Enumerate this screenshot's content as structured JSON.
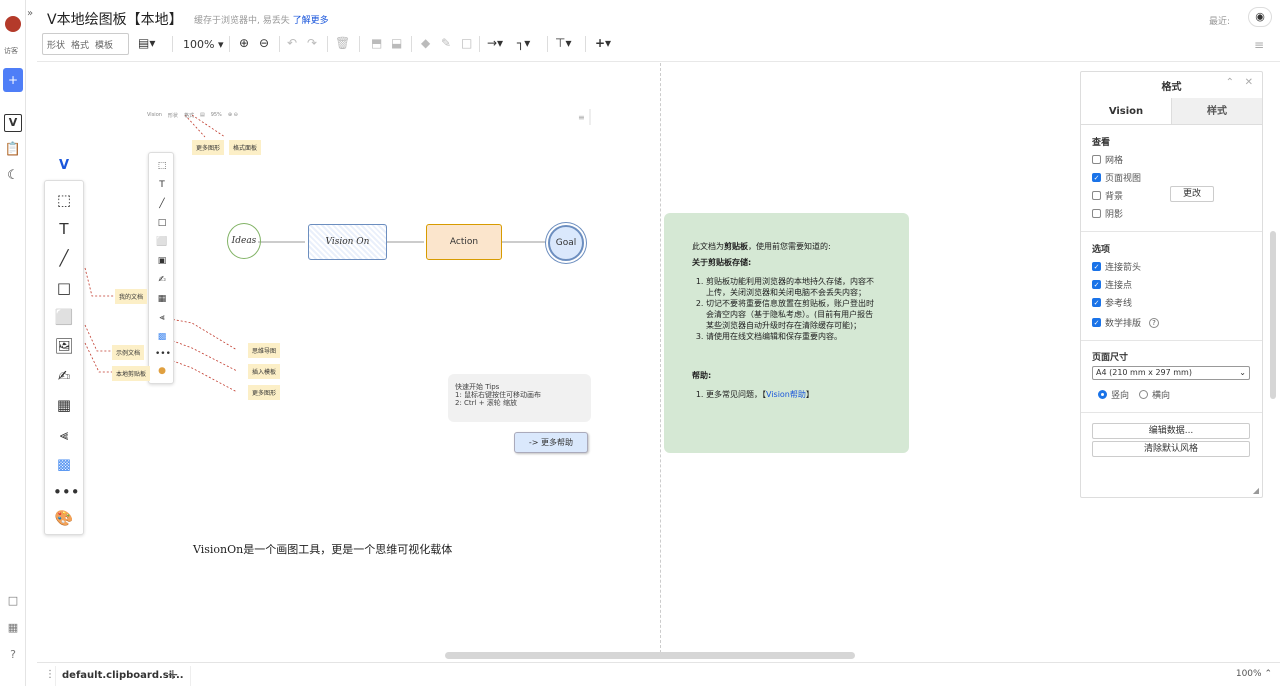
{
  "rail": {
    "vip_label": "访客",
    "add_label": "+"
  },
  "header": {
    "title": "V本地绘图板【本地】",
    "subtitle": "缓存于浏览器中, 易丢失",
    "learn_more": "了解更多",
    "recent": "最近:",
    "tool_group": [
      "形状",
      "格式",
      "模板"
    ],
    "zoom": "100%"
  },
  "canvas": {
    "mini_toolbar": {
      "vision": "Vision",
      "shape": "形状",
      "format": "格式",
      "zoom": "95%"
    },
    "tags": {
      "more_shapes": "更多图形",
      "format_panel": "格式面板",
      "my_docs": "我的文档",
      "examples": "示例文档",
      "local_clipboard": "本地剪贴板",
      "mindmap": "思维导图",
      "insert_template": "插入模板",
      "more_shapes2": "更多图形"
    },
    "flow": {
      "ideas": "Ideas",
      "vision_on": "Vision On",
      "action": "Action",
      "goal": "Goal"
    },
    "tips": {
      "title": "快速开始 Tips",
      "line1": "1:   鼠标右键按住可移动画布",
      "line2": "2:   Ctrl + 滚轮 缩放"
    },
    "more_help": "-> 更多帮助",
    "tagline": "VisionOn是一个画图工具，更是一个思维可视化载体",
    "card": {
      "intro_pre": "此文档为",
      "intro_bold": "剪贴板",
      "intro_post": "，使用前您需要知道的:",
      "storage_title": "关于剪贴板存储:",
      "items": [
        "剪贴板功能利用浏览器的本地持久存储，内容不上传，关闭浏览器和关闭电脑不会丢失内容；",
        "切记不要将重要信息放置在剪贴板，账户登出时会清空内容（基于隐私考虑）。(目前有用户报告某些浏览器自动升级时存在清除缓存可能)；",
        "请使用在线文档编辑和保存重要内容。"
      ],
      "help_title": "帮助:",
      "help_pre": "更多常见问题，【",
      "help_link": "Vision帮助",
      "help_post": "】"
    }
  },
  "format_panel": {
    "title": "格式",
    "tabs": [
      "Vision",
      "样式"
    ],
    "view_title": "查看",
    "view_opts": [
      {
        "label": "网格",
        "checked": false
      },
      {
        "label": "页面视图",
        "checked": true
      },
      {
        "label": "背景",
        "checked": false
      },
      {
        "label": "阴影",
        "checked": false
      }
    ],
    "change_btn": "更改",
    "options_title": "选项",
    "options": [
      {
        "label": "连接箭头",
        "checked": true
      },
      {
        "label": "连接点",
        "checked": true
      },
      {
        "label": "参考线",
        "checked": true
      },
      {
        "label": "数学排版",
        "checked": true
      }
    ],
    "page_size_title": "页面尺寸",
    "page_size_value": "A4 (210 mm x 297 mm)",
    "portrait": "竖向",
    "landscape": "横向",
    "edit_data": "编辑数据...",
    "clear_style": "清除默认风格"
  },
  "bottom": {
    "file_tab": "default.clipboard.si...",
    "zoom": "100%"
  }
}
